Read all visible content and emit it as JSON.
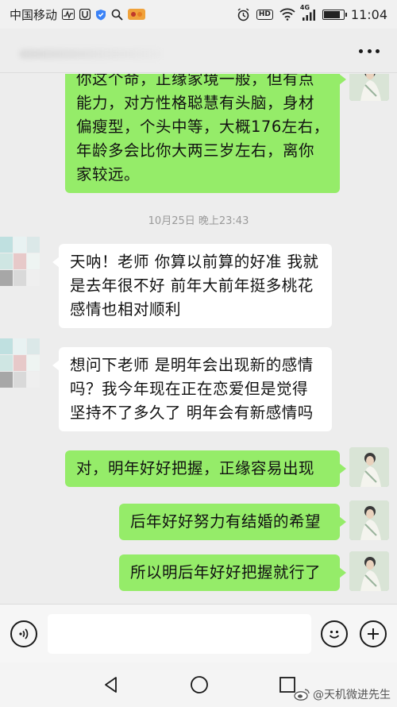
{
  "status_bar": {
    "carrier": "中国移动",
    "network": "4G",
    "hd_label": "HD",
    "battery_level": 0.85,
    "time": "11:04"
  },
  "header": {
    "more_icon": "more-dots-icon"
  },
  "messages": [
    {
      "direction": "out",
      "lines": [
        "你这个命，正缘家境一般，但有点",
        "能力，对方性格聪慧有头脑，身材",
        "偏瘦型，个头中等，大概176左右，",
        "年龄多会比你大两三岁左右，离你",
        "家较远。"
      ]
    },
    {
      "type": "timestamp",
      "text": "10月25日 晚上23:43"
    },
    {
      "direction": "in",
      "lines": [
        "天呐！老师 你算以前算的好准 我就",
        "是去年很不好 前年大前年挺多桃花",
        "感情也相对顺利"
      ]
    },
    {
      "direction": "in",
      "lines": [
        "想问下老师 是明年会出现新的感情",
        "吗？我今年现在正在恋爱但是觉得",
        "坚持不了多久了 明年会有新感情吗"
      ]
    },
    {
      "direction": "out",
      "lines": [
        "对，明年好好把握，正缘容易出现"
      ]
    },
    {
      "direction": "out",
      "lines": [
        "后年好好努力有结婚的希望"
      ]
    },
    {
      "direction": "out",
      "lines": [
        "所以明后年好好把握就行了"
      ]
    }
  ],
  "input_bar": {
    "voice_icon": "voice-icon",
    "emoji_icon": "emoji-icon",
    "plus_icon": "plus-icon",
    "message_value": ""
  },
  "watermark": {
    "text": "@天机微进先生"
  },
  "colors": {
    "outgoing_bubble": "#95ec69",
    "incoming_bubble": "#ffffff",
    "chat_background": "#ededed"
  }
}
